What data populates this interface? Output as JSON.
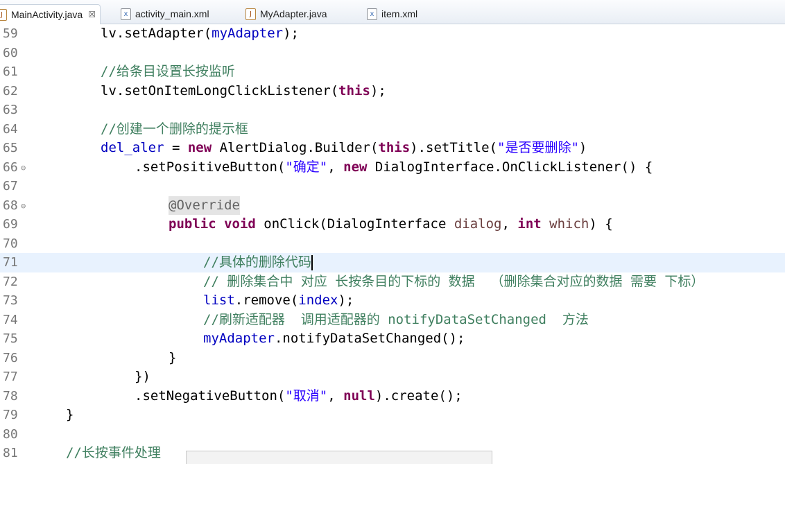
{
  "tabs": [
    {
      "label": "MainActivity.java",
      "icon": "java-file-icon",
      "active": true,
      "close": "☒"
    },
    {
      "label": "activity_main.xml",
      "icon": "xml-file-icon",
      "active": false
    },
    {
      "label": "MyAdapter.java",
      "icon": "java-file-icon",
      "active": false
    },
    {
      "label": "item.xml",
      "icon": "xml-file-icon",
      "active": false
    }
  ],
  "lines": [
    {
      "n": "59"
    },
    {
      "n": "60"
    },
    {
      "n": "61"
    },
    {
      "n": "62"
    },
    {
      "n": "63"
    },
    {
      "n": "64"
    },
    {
      "n": "65"
    },
    {
      "n": "66",
      "fold": "⊖"
    },
    {
      "n": "67"
    },
    {
      "n": "68",
      "fold": "⊖"
    },
    {
      "n": "69"
    },
    {
      "n": "70"
    },
    {
      "n": "71"
    },
    {
      "n": "72"
    },
    {
      "n": "73"
    },
    {
      "n": "74"
    },
    {
      "n": "75"
    },
    {
      "n": "76"
    },
    {
      "n": "77"
    },
    {
      "n": "78"
    },
    {
      "n": "79"
    },
    {
      "n": "80"
    },
    {
      "n": "81"
    }
  ],
  "code": {
    "l59_a": "lv.setAdapter(",
    "l59_b": "myAdapter",
    "l59_c": ");",
    "l61": "//给条目设置长按监听",
    "l62_a": "lv.setOnItemLongClickListener(",
    "l62_b": "this",
    "l62_c": ");",
    "l64": "//创建一个删除的提示框",
    "l65_a": "del_aler",
    "l65_b": " = ",
    "l65_c": "new",
    "l65_d": " AlertDialog.Builder(",
    "l65_e": "this",
    "l65_f": ").setTitle(",
    "l65_g": "\"是否要删除\"",
    "l65_h": ")",
    "l66_a": ".setPositiveButton(",
    "l66_b": "\"确定\"",
    "l66_c": ", ",
    "l66_d": "new",
    "l66_e": " DialogInterface.OnClickListener() {",
    "l68": "@Override",
    "l69_a": "public",
    "l69_b": "void",
    "l69_c": " onClick(DialogInterface ",
    "l69_d": "dialog",
    "l69_e": ", ",
    "l69_f": "int",
    "l69_g": " ",
    "l69_h": "which",
    "l69_i": ") {",
    "l71": "//具体的删除代码",
    "l72": "// 删除集合中 对应 长按条目的下标的 数据  （删除集合对应的数据 需要 下标）",
    "l73_a": "list",
    "l73_b": ".remove(",
    "l73_c": "index",
    "l73_d": ");",
    "l74": "//刷新适配器  调用适配器的 notifyDataSetChanged  方法",
    "l75_a": "myAdapter",
    "l75_b": ".notifyDataSetChanged();",
    "l76": "}",
    "l77": "})",
    "l78_a": ".setNegativeButton(",
    "l78_b": "\"取消\"",
    "l78_c": ", ",
    "l78_d": "null",
    "l78_e": ").create();",
    "l79": "}",
    "l81": "//长按事件处理"
  },
  "colors": {
    "keyword": "#7f0055",
    "comment": "#3f7f5f",
    "string": "#2a00ff",
    "field": "#0000c0",
    "current_line": "#e8f2fe"
  }
}
